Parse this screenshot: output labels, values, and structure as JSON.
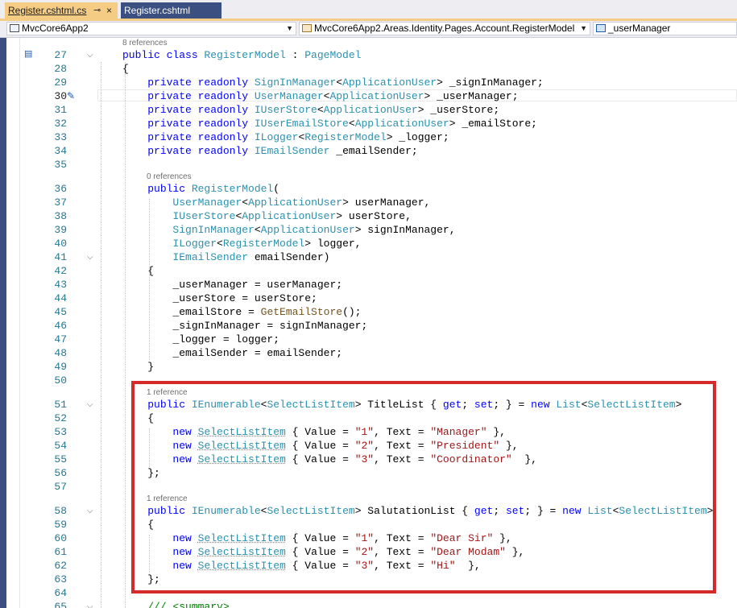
{
  "tabs": [
    {
      "label": "Register.cshtml.cs",
      "active": true,
      "pinned": true
    },
    {
      "label": "Register.cshtml",
      "active": false
    }
  ],
  "navbar": {
    "project": "MvcCore6App2",
    "type": "MvcCore6App2.Areas.Identity.Pages.Account.RegisterModel",
    "member": "_userManager"
  },
  "colors": {
    "keyword": "#0000ff",
    "type": "#2b91af",
    "string": "#a31515",
    "method": "#74531f",
    "comment": "#008000",
    "line_number": "#237893",
    "highlight_box": "#d42a2a",
    "active_tab": "#f5cc84"
  },
  "current_line": "30",
  "codelens": {
    "class_refs": "8 references",
    "ctor_refs": "0 references",
    "titlelist_refs": "1 reference",
    "salutationlist_refs": "1 reference"
  },
  "editor": {
    "lines": [
      {
        "n": "27",
        "fold": true,
        "tokens": [
          [
            "kw",
            "public class "
          ],
          [
            "ty",
            "RegisterModel"
          ],
          [
            "p",
            " : "
          ],
          [
            "ty",
            "PageModel"
          ]
        ]
      },
      {
        "n": "28",
        "tokens": [
          [
            "p",
            "{"
          ]
        ]
      },
      {
        "n": "29",
        "tokens": [
          [
            "p",
            "    "
          ],
          [
            "kw",
            "private readonly "
          ],
          [
            "ty",
            "SignInManager"
          ],
          [
            "p",
            "<"
          ],
          [
            "ty",
            "ApplicationUser"
          ],
          [
            "p",
            "> _signInManager;"
          ]
        ]
      },
      {
        "n": "30",
        "tokens": [
          [
            "p",
            "    "
          ],
          [
            "kw",
            "private readonly "
          ],
          [
            "ty",
            "UserManager"
          ],
          [
            "p",
            "<"
          ],
          [
            "ty",
            "ApplicationUser"
          ],
          [
            "p",
            "> _userManager;"
          ]
        ]
      },
      {
        "n": "31",
        "tokens": [
          [
            "p",
            "    "
          ],
          [
            "kw",
            "private readonly "
          ],
          [
            "ty",
            "IUserStore"
          ],
          [
            "p",
            "<"
          ],
          [
            "ty",
            "ApplicationUser"
          ],
          [
            "p",
            "> _userStore;"
          ]
        ]
      },
      {
        "n": "32",
        "tokens": [
          [
            "p",
            "    "
          ],
          [
            "kw",
            "private readonly "
          ],
          [
            "ty",
            "IUserEmailStore"
          ],
          [
            "p",
            "<"
          ],
          [
            "ty",
            "ApplicationUser"
          ],
          [
            "p",
            "> _emailStore;"
          ]
        ]
      },
      {
        "n": "33",
        "tokens": [
          [
            "p",
            "    "
          ],
          [
            "kw",
            "private readonly "
          ],
          [
            "ty",
            "ILogger"
          ],
          [
            "p",
            "<"
          ],
          [
            "ty",
            "RegisterModel"
          ],
          [
            "p",
            "> _logger;"
          ]
        ]
      },
      {
        "n": "34",
        "tokens": [
          [
            "p",
            "    "
          ],
          [
            "kw",
            "private readonly "
          ],
          [
            "ty",
            "IEmailSender"
          ],
          [
            "p",
            " _emailSender;"
          ]
        ]
      },
      {
        "n": "35",
        "tokens": []
      },
      {
        "n": "36",
        "tokens": [
          [
            "p",
            "    "
          ],
          [
            "kw",
            "public "
          ],
          [
            "ty",
            "RegisterModel"
          ],
          [
            "p",
            "("
          ]
        ]
      },
      {
        "n": "37",
        "tokens": [
          [
            "p",
            "        "
          ],
          [
            "ty",
            "UserManager"
          ],
          [
            "p",
            "<"
          ],
          [
            "ty",
            "ApplicationUser"
          ],
          [
            "p",
            "> userManager,"
          ]
        ]
      },
      {
        "n": "38",
        "tokens": [
          [
            "p",
            "        "
          ],
          [
            "ty",
            "IUserStore"
          ],
          [
            "p",
            "<"
          ],
          [
            "ty",
            "ApplicationUser"
          ],
          [
            "p",
            "> userStore,"
          ]
        ]
      },
      {
        "n": "39",
        "tokens": [
          [
            "p",
            "        "
          ],
          [
            "ty",
            "SignInManager"
          ],
          [
            "p",
            "<"
          ],
          [
            "ty",
            "ApplicationUser"
          ],
          [
            "p",
            "> signInManager,"
          ]
        ]
      },
      {
        "n": "40",
        "tokens": [
          [
            "p",
            "        "
          ],
          [
            "ty",
            "ILogger"
          ],
          [
            "p",
            "<"
          ],
          [
            "ty",
            "RegisterModel"
          ],
          [
            "p",
            "> logger,"
          ]
        ]
      },
      {
        "n": "41",
        "fold": true,
        "tokens": [
          [
            "p",
            "        "
          ],
          [
            "ty",
            "IEmailSender"
          ],
          [
            "p",
            " emailSender)"
          ]
        ]
      },
      {
        "n": "42",
        "tokens": [
          [
            "p",
            "    {"
          ]
        ]
      },
      {
        "n": "43",
        "tokens": [
          [
            "p",
            "        _userManager = userManager;"
          ]
        ]
      },
      {
        "n": "44",
        "tokens": [
          [
            "p",
            "        _userStore = userStore;"
          ]
        ]
      },
      {
        "n": "45",
        "tokens": [
          [
            "p",
            "        _emailStore = "
          ],
          [
            "mt",
            "GetEmailStore"
          ],
          [
            "p",
            "();"
          ]
        ]
      },
      {
        "n": "46",
        "tokens": [
          [
            "p",
            "        _signInManager = signInManager;"
          ]
        ]
      },
      {
        "n": "47",
        "tokens": [
          [
            "p",
            "        _logger = logger;"
          ]
        ]
      },
      {
        "n": "48",
        "tokens": [
          [
            "p",
            "        _emailSender = emailSender;"
          ]
        ]
      },
      {
        "n": "49",
        "tokens": [
          [
            "p",
            "    }"
          ]
        ]
      },
      {
        "n": "50",
        "tokens": []
      },
      {
        "n": "51",
        "fold": true,
        "tokens": [
          [
            "p",
            "    "
          ],
          [
            "kw",
            "public "
          ],
          [
            "ty",
            "IEnumerable"
          ],
          [
            "p",
            "<"
          ],
          [
            "ty",
            "SelectListItem"
          ],
          [
            "p",
            "> TitleList { "
          ],
          [
            "kw",
            "get"
          ],
          [
            "p",
            "; "
          ],
          [
            "kw",
            "set"
          ],
          [
            "p",
            "; } = "
          ],
          [
            "kw",
            "new "
          ],
          [
            "ty",
            "List"
          ],
          [
            "p",
            "<"
          ],
          [
            "ty",
            "SelectListItem"
          ],
          [
            "p",
            ">"
          ]
        ]
      },
      {
        "n": "52",
        "tokens": [
          [
            "p",
            "    {"
          ]
        ]
      },
      {
        "n": "53",
        "tokens": [
          [
            "p",
            "        "
          ],
          [
            "kw",
            "new "
          ],
          [
            "tyu",
            "SelectListItem"
          ],
          [
            "p",
            " { Value = "
          ],
          [
            "st",
            "\"1\""
          ],
          [
            "p",
            ", Text = "
          ],
          [
            "st",
            "\"Manager\""
          ],
          [
            "p",
            " },"
          ]
        ]
      },
      {
        "n": "54",
        "tokens": [
          [
            "p",
            "        "
          ],
          [
            "kw",
            "new "
          ],
          [
            "tyu",
            "SelectListItem"
          ],
          [
            "p",
            " { Value = "
          ],
          [
            "st",
            "\"2\""
          ],
          [
            "p",
            ", Text = "
          ],
          [
            "st",
            "\"President\""
          ],
          [
            "p",
            " },"
          ]
        ]
      },
      {
        "n": "55",
        "tokens": [
          [
            "p",
            "        "
          ],
          [
            "kw",
            "new "
          ],
          [
            "tyu",
            "SelectListItem"
          ],
          [
            "p",
            " { Value = "
          ],
          [
            "st",
            "\"3\""
          ],
          [
            "p",
            ", Text = "
          ],
          [
            "st",
            "\"Coordinator\""
          ],
          [
            "p",
            "  },"
          ]
        ]
      },
      {
        "n": "56",
        "tokens": [
          [
            "p",
            "    };"
          ]
        ]
      },
      {
        "n": "57",
        "tokens": []
      },
      {
        "n": "58",
        "fold": true,
        "tokens": [
          [
            "p",
            "    "
          ],
          [
            "kw",
            "public "
          ],
          [
            "ty",
            "IEnumerable"
          ],
          [
            "p",
            "<"
          ],
          [
            "ty",
            "SelectListItem"
          ],
          [
            "p",
            "> SalutationList { "
          ],
          [
            "kw",
            "get"
          ],
          [
            "p",
            "; "
          ],
          [
            "kw",
            "set"
          ],
          [
            "p",
            "; } = "
          ],
          [
            "kw",
            "new "
          ],
          [
            "ty",
            "List"
          ],
          [
            "p",
            "<"
          ],
          [
            "ty",
            "SelectListItem"
          ],
          [
            "p",
            ">"
          ]
        ]
      },
      {
        "n": "59",
        "tokens": [
          [
            "p",
            "    {"
          ]
        ]
      },
      {
        "n": "60",
        "tokens": [
          [
            "p",
            "        "
          ],
          [
            "kw",
            "new "
          ],
          [
            "tyu",
            "SelectListItem"
          ],
          [
            "p",
            " { Value = "
          ],
          [
            "st",
            "\"1\""
          ],
          [
            "p",
            ", Text = "
          ],
          [
            "st",
            "\"Dear Sir\""
          ],
          [
            "p",
            " },"
          ]
        ]
      },
      {
        "n": "61",
        "tokens": [
          [
            "p",
            "        "
          ],
          [
            "kw",
            "new "
          ],
          [
            "tyu",
            "SelectListItem"
          ],
          [
            "p",
            " { Value = "
          ],
          [
            "st",
            "\"2\""
          ],
          [
            "p",
            ", Text = "
          ],
          [
            "st",
            "\"Dear Modam\""
          ],
          [
            "p",
            " },"
          ]
        ]
      },
      {
        "n": "62",
        "tokens": [
          [
            "p",
            "        "
          ],
          [
            "kw",
            "new "
          ],
          [
            "tyu",
            "SelectListItem"
          ],
          [
            "p",
            " { Value = "
          ],
          [
            "st",
            "\"3\""
          ],
          [
            "p",
            ", Text = "
          ],
          [
            "st",
            "\"Hi\""
          ],
          [
            "p",
            "  },"
          ]
        ]
      },
      {
        "n": "63",
        "tokens": [
          [
            "p",
            "    };"
          ]
        ]
      },
      {
        "n": "64",
        "tokens": []
      },
      {
        "n": "65",
        "fold": true,
        "tokens": [
          [
            "p",
            "    "
          ],
          [
            "cm",
            "/// <summary>"
          ]
        ]
      }
    ]
  }
}
